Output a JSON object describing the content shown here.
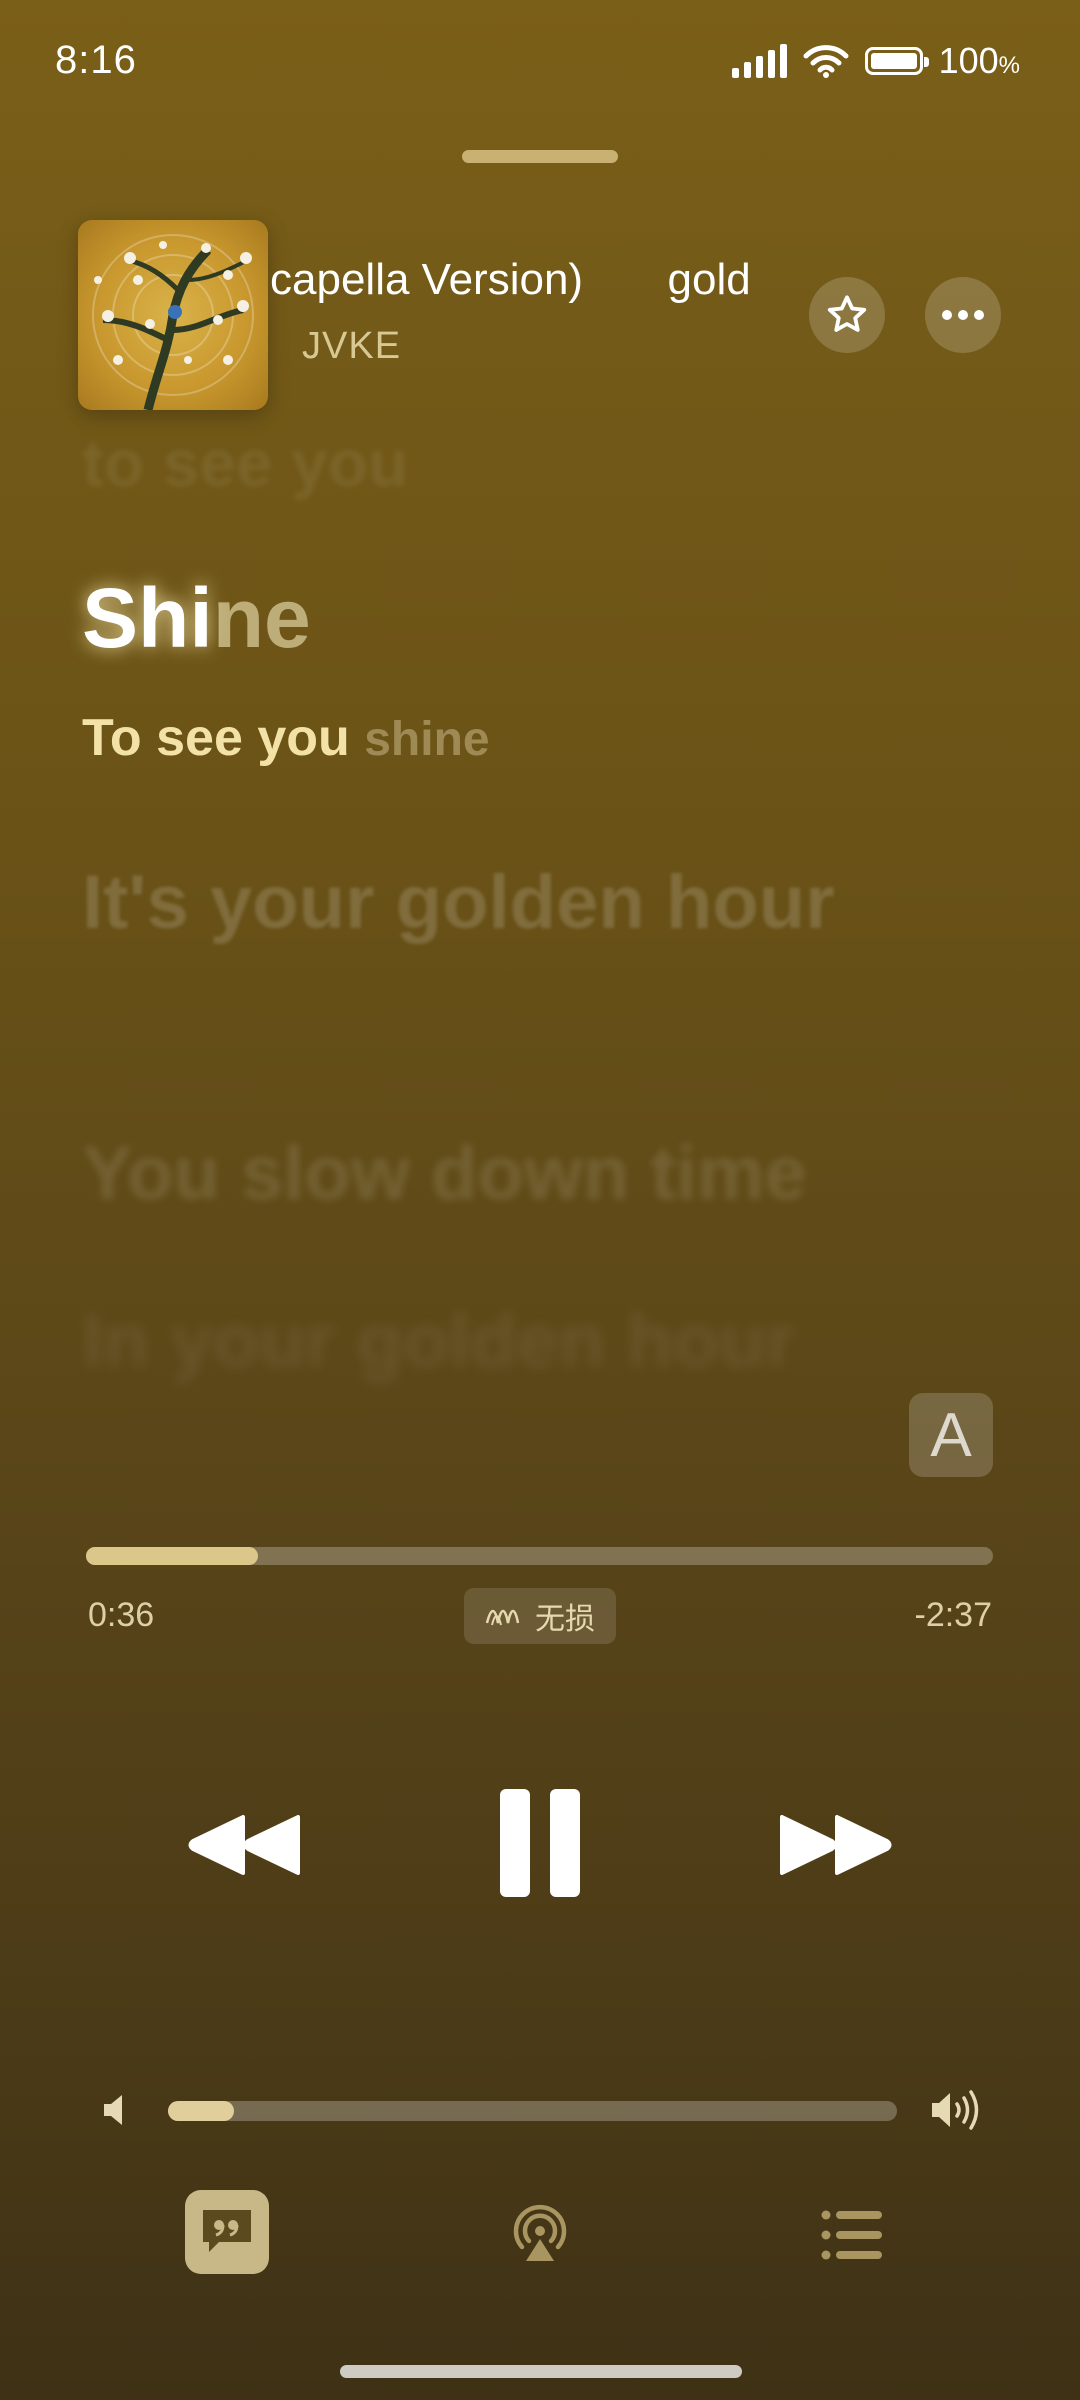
{
  "status_bar": {
    "time": "8:16",
    "battery_pct": "100",
    "battery_unit": "%",
    "icons": [
      "signal-icon",
      "wifi-icon",
      "battery-icon"
    ]
  },
  "now_playing": {
    "title_visible": "capella Version)",
    "title_next": "gold",
    "artist": "JVKE",
    "cover_icon": "album-art"
  },
  "actions": {
    "favorite_icon": "star-icon",
    "more_icon": "more-icon"
  },
  "lyrics": {
    "previous": "to see you",
    "current_sung": "Shi",
    "current_rest": "ne",
    "sub_sung": "To see you",
    "sub_rest": "shine",
    "next1": "It's your golden hour",
    "next2": "You slow down time",
    "next3": "In your golden hour",
    "translate_label": "A"
  },
  "playback": {
    "elapsed": "0:36",
    "remaining": "-2:37",
    "progress_fraction": 0.19,
    "quality_label": "无损",
    "quality_icon": "lossless-icon"
  },
  "controls": {
    "rewind_icon": "rewind-icon",
    "pause_icon": "pause-icon",
    "forward_icon": "fast-forward-icon"
  },
  "volume": {
    "level_fraction": 0.09,
    "low_icon": "volume-low-icon",
    "high_icon": "volume-high-icon"
  },
  "bottom_bar": {
    "lyrics_icon": "lyrics-quote-icon",
    "airplay_icon": "airplay-icon",
    "queue_icon": "queue-list-icon"
  },
  "colors": {
    "background_top": "#7a5f18",
    "background_bottom": "#3e3115",
    "accent": "#dcc78b"
  }
}
